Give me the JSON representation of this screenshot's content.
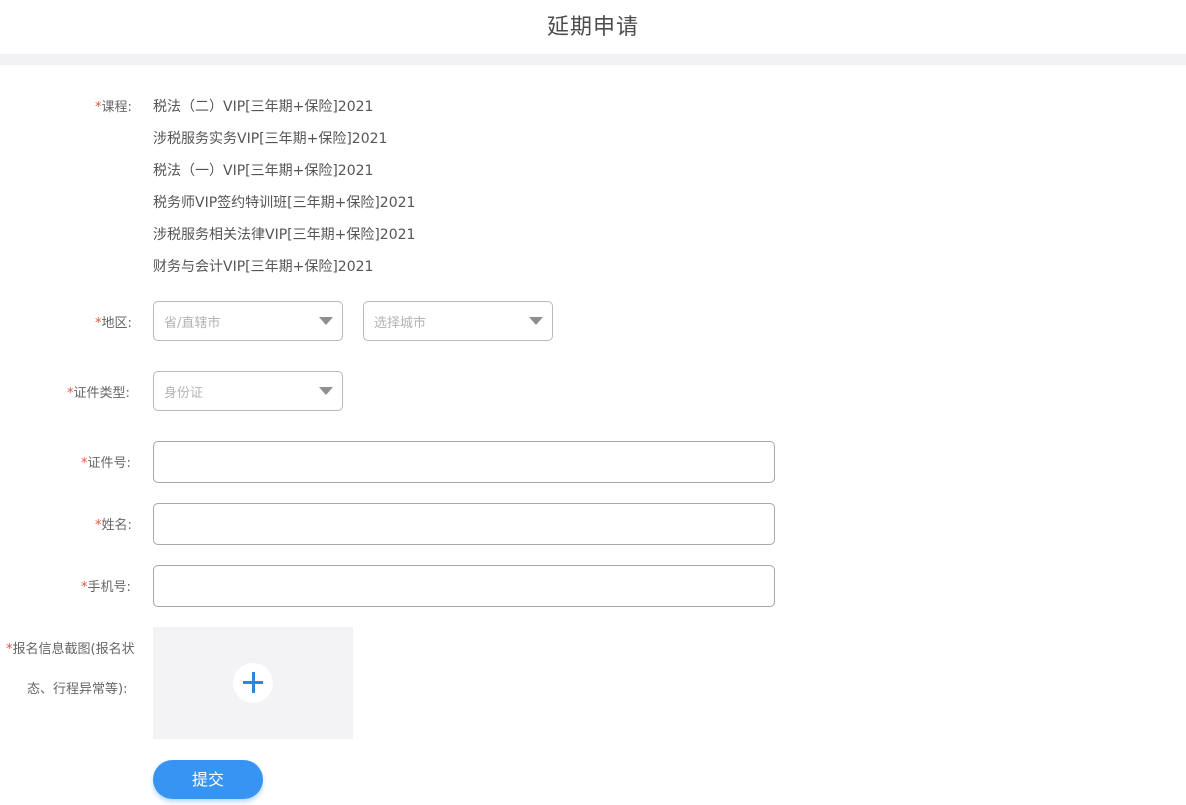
{
  "header": {
    "title": "延期申请"
  },
  "form": {
    "required_mark": "*",
    "course": {
      "label": "课程:",
      "items": [
        "税法（二）VIP[三年期+保险]2021",
        "涉税服务实务VIP[三年期+保险]2021",
        "税法（一）VIP[三年期+保险]2021",
        "税务师VIP签约特训班[三年期+保险]2021",
        "涉税服务相关法律VIP[三年期+保险]2021",
        "财务与会计VIP[三年期+保险]2021"
      ]
    },
    "region": {
      "label": "地区:",
      "province_placeholder": "省/直辖市",
      "city_placeholder": "选择城市"
    },
    "id_type": {
      "label": "证件类型:",
      "value": "身份证"
    },
    "id_number": {
      "label": "证件号:",
      "value": ""
    },
    "name": {
      "label": "姓名:",
      "value": ""
    },
    "phone": {
      "label": "手机号:",
      "value": ""
    },
    "screenshot": {
      "label_line1": "报名信息截图(报名状",
      "label_line2": "态、行程异常等):"
    },
    "submit_label": "提交"
  },
  "colors": {
    "accent": "#3794f2",
    "required": "#e2553e",
    "upload_bg": "#f3f3f5"
  },
  "icons": {
    "select_caret": "chevron-down-icon",
    "upload": "plus-icon"
  }
}
